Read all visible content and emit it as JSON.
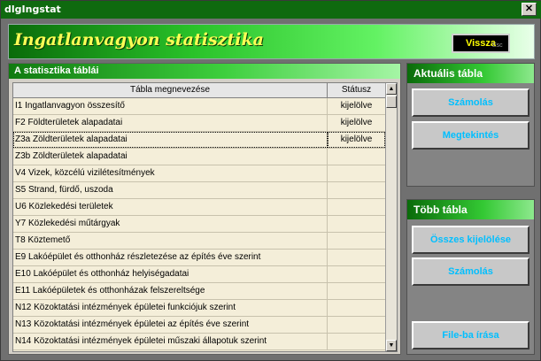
{
  "window": {
    "title": "dlgIngstat",
    "close_glyph": "✕"
  },
  "header": {
    "title": "Ingatlanvagyon statisztika",
    "back_button": "Vissza",
    "back_button_ghost": "Esc"
  },
  "left_panel": {
    "caption": "A statisztika táblái",
    "columns": [
      "Tábla megnevezése",
      "Státusz"
    ],
    "rows": [
      {
        "name": "I1 Ingatlanvagyon összesítő",
        "status": "kijelölve"
      },
      {
        "name": "F2 Földterületek alapadatai",
        "status": "kijelölve"
      },
      {
        "name": "Z3a Zöldterületek alapadatai",
        "status": "kijelölve"
      },
      {
        "name": "Z3b Zöldterületek alapadatai",
        "status": ""
      },
      {
        "name": "V4 Vizek, közcélú vizilétesítmények",
        "status": ""
      },
      {
        "name": "S5 Strand, fürdő, uszoda",
        "status": ""
      },
      {
        "name": "U6 Közlekedési területek",
        "status": ""
      },
      {
        "name": "Y7 Közlekedési műtárgyak",
        "status": ""
      },
      {
        "name": "T8 Köztemető",
        "status": ""
      },
      {
        "name": "E9 Lakóépület és otthonház részletezése az építés éve szerint",
        "status": ""
      },
      {
        "name": "E10 Lakóépület és otthonház helyiségadatai",
        "status": ""
      },
      {
        "name": "E11 Lakóépületek és otthonházak felszereltsége",
        "status": ""
      },
      {
        "name": "N12 Közoktatási intézmények épületei funkciójuk szerint",
        "status": ""
      },
      {
        "name": "N13 Közoktatási intézmények épületei az építés éve szerint",
        "status": ""
      },
      {
        "name": "N14 Közoktatási intézmények épületei műszaki állapotuk szerint",
        "status": ""
      }
    ],
    "selected_index": 2,
    "scroll_up_glyph": "▲",
    "scroll_down_glyph": "▼"
  },
  "current_table_panel": {
    "caption": "Aktuális tábla",
    "buttons": [
      "Számolás",
      "Megtekintés"
    ]
  },
  "multi_table_panel": {
    "caption": "Több tábla",
    "buttons": [
      "Összes kijelölése",
      "Számolás",
      "File-ba írása"
    ]
  },
  "colors": {
    "accent_green": "#0f6a0f",
    "title_yellow": "#ffff55",
    "button_text": "#00bfff",
    "table_bg": "#f4eed9"
  }
}
